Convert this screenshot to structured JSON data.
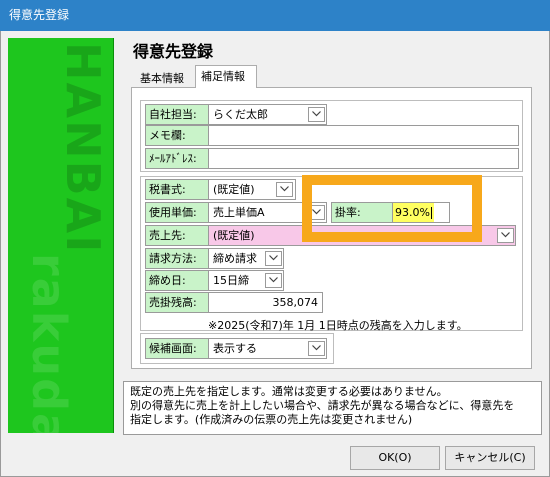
{
  "window": {
    "title": "得意先登録"
  },
  "form_title": "得意先登録",
  "tabs": [
    {
      "label": "基本情報",
      "selected": false
    },
    {
      "label": "補足情報",
      "selected": true
    }
  ],
  "fields": {
    "own_staff": {
      "label": "自社担当:",
      "value": "らくだ太郎"
    },
    "memo": {
      "label": "メモ欄:",
      "value": ""
    },
    "mail_address": {
      "label": "ﾒｰﾙｱﾄﾞﾚｽ:",
      "value": ""
    },
    "tax_format": {
      "label": "税書式:",
      "value": "(既定値)"
    },
    "unit_price": {
      "label": "使用単価:",
      "value": "売上単価A"
    },
    "rate": {
      "label": "掛率:",
      "value": "93.0%"
    },
    "sales_destination": {
      "label": "売上先:",
      "value": "(既定値)"
    },
    "billing_method": {
      "label": "請求方法:",
      "value": "締め請求"
    },
    "closing_day": {
      "label": "締め日:",
      "value": "15日締"
    },
    "ar_balance": {
      "label": "売掛残高:",
      "value": "358,074"
    },
    "candidate_screen": {
      "label": "候補画面:",
      "value": "表示する"
    }
  },
  "balance_note": "※2025(令和7)年 1月 1日時点の残高を入力します。",
  "hint_lines": [
    "既定の売上先を指定します。通常は変更する必要はありません。",
    "別の得意先に売上を計上したい場合や、請求先が異なる場合などに、得意先を",
    "指定します。(作成済みの伝票の売上先は変更されません)"
  ],
  "buttons": {
    "ok": "OK(O)",
    "cancel": "キャンセル(C)"
  },
  "banner": {
    "text_top": "HANBAI",
    "text_bottom": "rakuda"
  },
  "colors": {
    "title_bar": "#2d82c8",
    "banner_green": "#1ec61e",
    "label_green": "#c9f3c9",
    "sales_dest_pink": "#f8c8e8",
    "rate_yellow": "#ffff60",
    "highlight_orange": "#f7a81b"
  }
}
